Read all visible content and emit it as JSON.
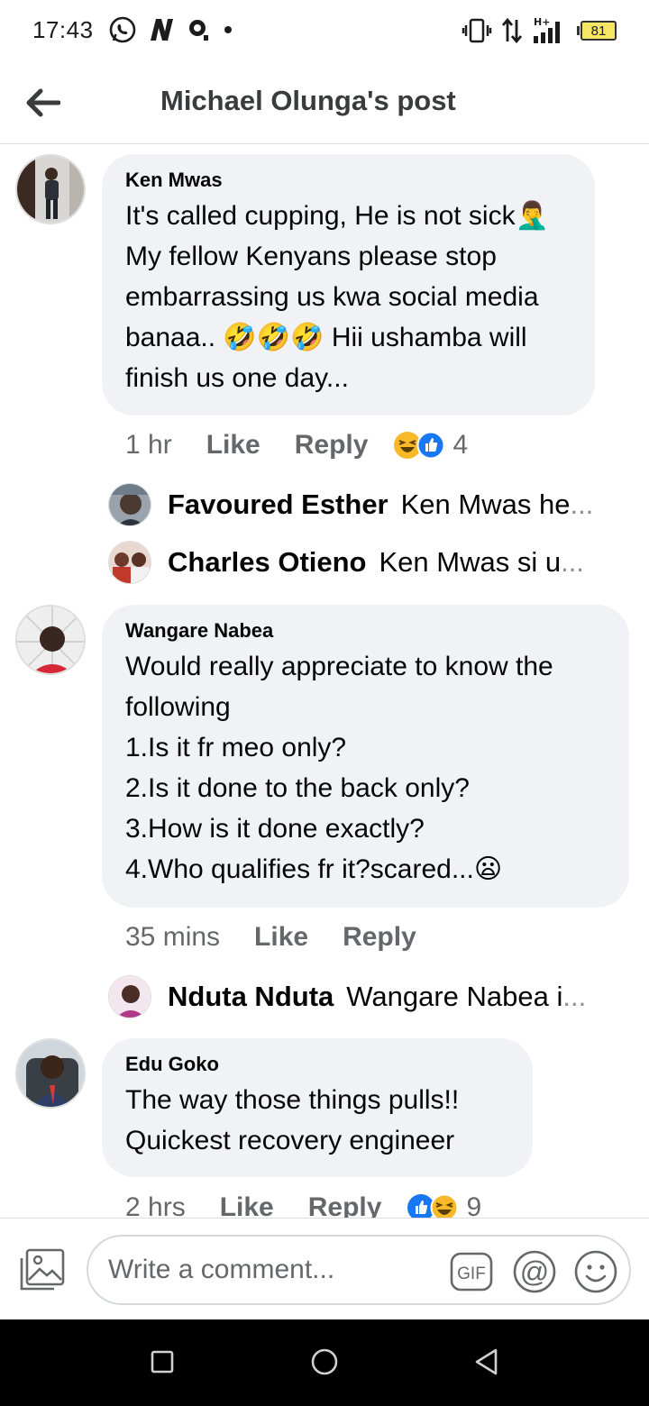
{
  "status_bar": {
    "time": "17:43",
    "battery": "81",
    "network": "H+"
  },
  "header": {
    "title": "Michael Olunga's post"
  },
  "comments": [
    {
      "author": "Ken Mwas",
      "text": "It's called cupping, He is not sick🤦‍♂️ My fellow Kenyans please stop embarrassing us kwa social media banaa.. 🤣🤣🤣 Hii ushamba will finish us one day...",
      "time": "1 hr",
      "like_label": "Like",
      "reply_label": "Reply",
      "reaction_count": "4",
      "reactions": [
        "haha",
        "like"
      ],
      "replies": [
        {
          "name": "Favoured Esther",
          "snippet": "Ken Mwas he"
        },
        {
          "name": "Charles Otieno",
          "snippet": "Ken Mwas  si u"
        }
      ]
    },
    {
      "author": "Wangare Nabea",
      "text": "Would really appreciate to know the following\n1.Is it fr meo only?\n2.Is it done to the back only?\n3.How is it done exactly?\n4.Who qualifies fr it?scared...😦",
      "time": "35 mins",
      "like_label": "Like",
      "reply_label": "Reply",
      "replies": [
        {
          "name": "Nduta Nduta",
          "snippet": "Wangare Nabea i"
        }
      ]
    },
    {
      "author": "Edu Goko",
      "text": "The way those things pulls!!\nQuickest recovery engineer",
      "time": "2 hrs",
      "like_label": "Like",
      "reply_label": "Reply",
      "reaction_count": "9",
      "reactions": [
        "like",
        "haha"
      ]
    }
  ],
  "composer": {
    "placeholder": "Write a comment...",
    "gif_label": "GIF",
    "at_label": "@"
  },
  "colors": {
    "bubble": "#f0f2f5",
    "secondary_text": "#65676b",
    "like_blue": "#1877f2",
    "haha_yellow": "#f7b928"
  }
}
